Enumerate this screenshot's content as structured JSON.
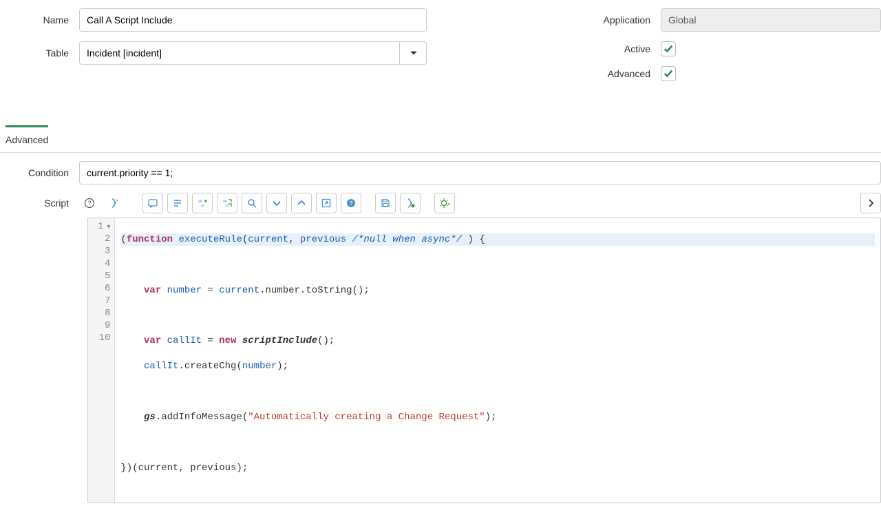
{
  "form": {
    "name_label": "Name",
    "name_value": "Call A Script Include",
    "table_label": "Table",
    "table_value": "Incident [incident]",
    "application_label": "Application",
    "application_value": "Global",
    "active_label": "Active",
    "advanced_label": "Advanced"
  },
  "tabs": {
    "advanced": "Advanced"
  },
  "advanced": {
    "condition_label": "Condition",
    "condition_value": "current.priority == 1;",
    "script_label": "Script"
  },
  "code": {
    "l1": {
      "a": "(",
      "b": "function",
      "c": " ",
      "d": "executeRule",
      "e": "(",
      "f": "current",
      "g": ", ",
      "h": "previous",
      "i": " ",
      "j": "/*null when async*/",
      "k": " ) {"
    },
    "l3": {
      "a": "    ",
      "b": "var",
      "c": " ",
      "d": "number",
      "e": " = ",
      "f": "current",
      "g": ".number.toString();"
    },
    "l5": {
      "a": "    ",
      "b": "var",
      "c": " ",
      "d": "callIt",
      "e": " = ",
      "f": "new",
      "g": " ",
      "h": "scriptInclude",
      "i": "();"
    },
    "l6": {
      "a": "    ",
      "b": "callIt",
      "c": ".createChg(",
      "d": "number",
      "e": ");"
    },
    "l8": {
      "a": "    ",
      "b": "gs",
      "c": ".addInfoMessage(",
      "d": "\"Automatically creating a Change Request\"",
      "e": ");"
    },
    "l10": {
      "a": "})(current, previous);"
    }
  },
  "line_numbers": [
    "1",
    "2",
    "3",
    "4",
    "5",
    "6",
    "7",
    "8",
    "9",
    "10"
  ]
}
